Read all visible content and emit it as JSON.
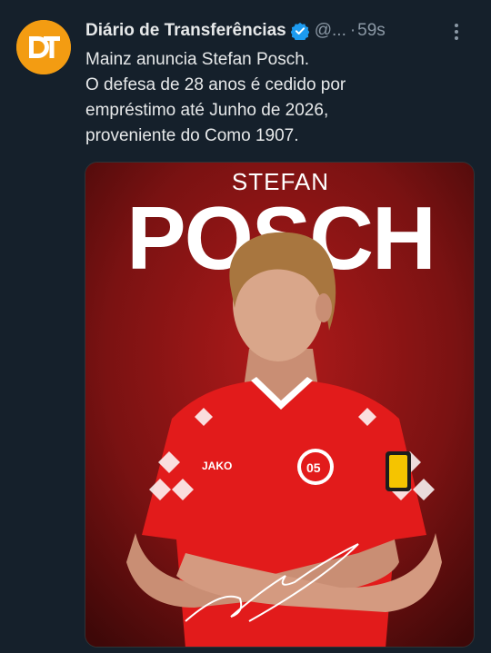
{
  "tweet": {
    "display_name": "Diário de Transferências",
    "handle": "@...",
    "separator": "·",
    "time": "59s",
    "avatar_icon": "dt-logo",
    "lines": [
      "Mainz anuncia Stefan Posch.",
      "O defesa de 28 anos é cedido por",
      "empréstimo até Junho de 2026,",
      "proveniente do Como 1907."
    ]
  },
  "media": {
    "first_name": "STEFAN",
    "last_name": "POSCH",
    "kit_brand": "JAKO",
    "club_badge": "05",
    "colors": {
      "background": "#6e1414",
      "shirt": "#e21b1b",
      "accent": "#ffffff"
    }
  },
  "colors": {
    "page_bg": "#15202b",
    "text": "#e7e9ea",
    "muted": "#8b98a5",
    "verified": "#1d9bf0",
    "avatar": "#f39c12"
  }
}
